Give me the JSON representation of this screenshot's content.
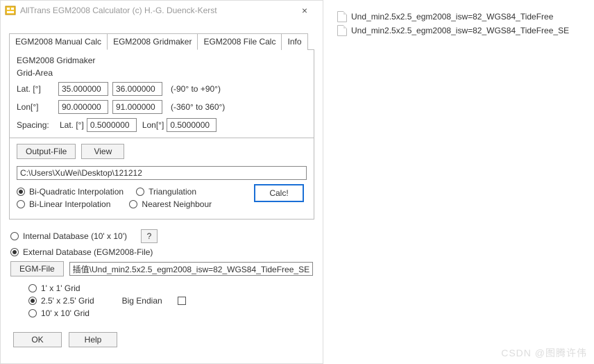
{
  "window": {
    "title": "AllTrans EGM2008 Calculator (c) H.-G. Duenck-Kerst",
    "close": "×"
  },
  "tabs": [
    "EGM2008 Manual Calc",
    "EGM2008 Gridmaker",
    "EGM2008 File Calc",
    "Info"
  ],
  "gridmaker": {
    "group": "EGM2008 Gridmaker",
    "area": "Grid-Area",
    "lat_label": "Lat. [°]",
    "lat_from": "35.000000",
    "lat_to": "36.000000",
    "lat_hint": "(-90° to +90°)",
    "lon_label": "Lon[°]",
    "lon_from": "90.000000",
    "lon_to": "91.000000",
    "lon_hint": "(-360° to 360°)",
    "spacing_label": "Spacing:",
    "sp_lat_label": "Lat. [°]",
    "sp_lat": "0.5000000",
    "sp_lon_label": "Lon[°]",
    "sp_lon": "0.5000000",
    "output_file": "Output-File",
    "view": "View",
    "path": "C:\\Users\\XuWei\\Desktop\\121212",
    "interp": {
      "biquad": "Bi-Quadratic Interpolation",
      "bilinear": "Bi-Linear Interpolation",
      "tri": "Triangulation",
      "nn": "Nearest Neighbour"
    },
    "calc": "Calc!"
  },
  "db": {
    "internal": "Internal Database (10' x 10')",
    "q": "?",
    "external": "External Database (EGM2008-File)",
    "egm_file": "EGM-File",
    "egm_path": "插值\\Und_min2.5x2.5_egm2008_isw=82_WGS84_TideFree_SE",
    "g1": "1' x 1' Grid",
    "g25": "2.5' x 2.5' Grid",
    "g10": "10' x 10' Grid",
    "bigendian": "Big Endian"
  },
  "buttons": {
    "ok": "OK",
    "help": "Help"
  },
  "files": [
    "Und_min2.5x2.5_egm2008_isw=82_WGS84_TideFree",
    "Und_min2.5x2.5_egm2008_isw=82_WGS84_TideFree_SE"
  ],
  "watermark": "CSDN @图腾许伟"
}
